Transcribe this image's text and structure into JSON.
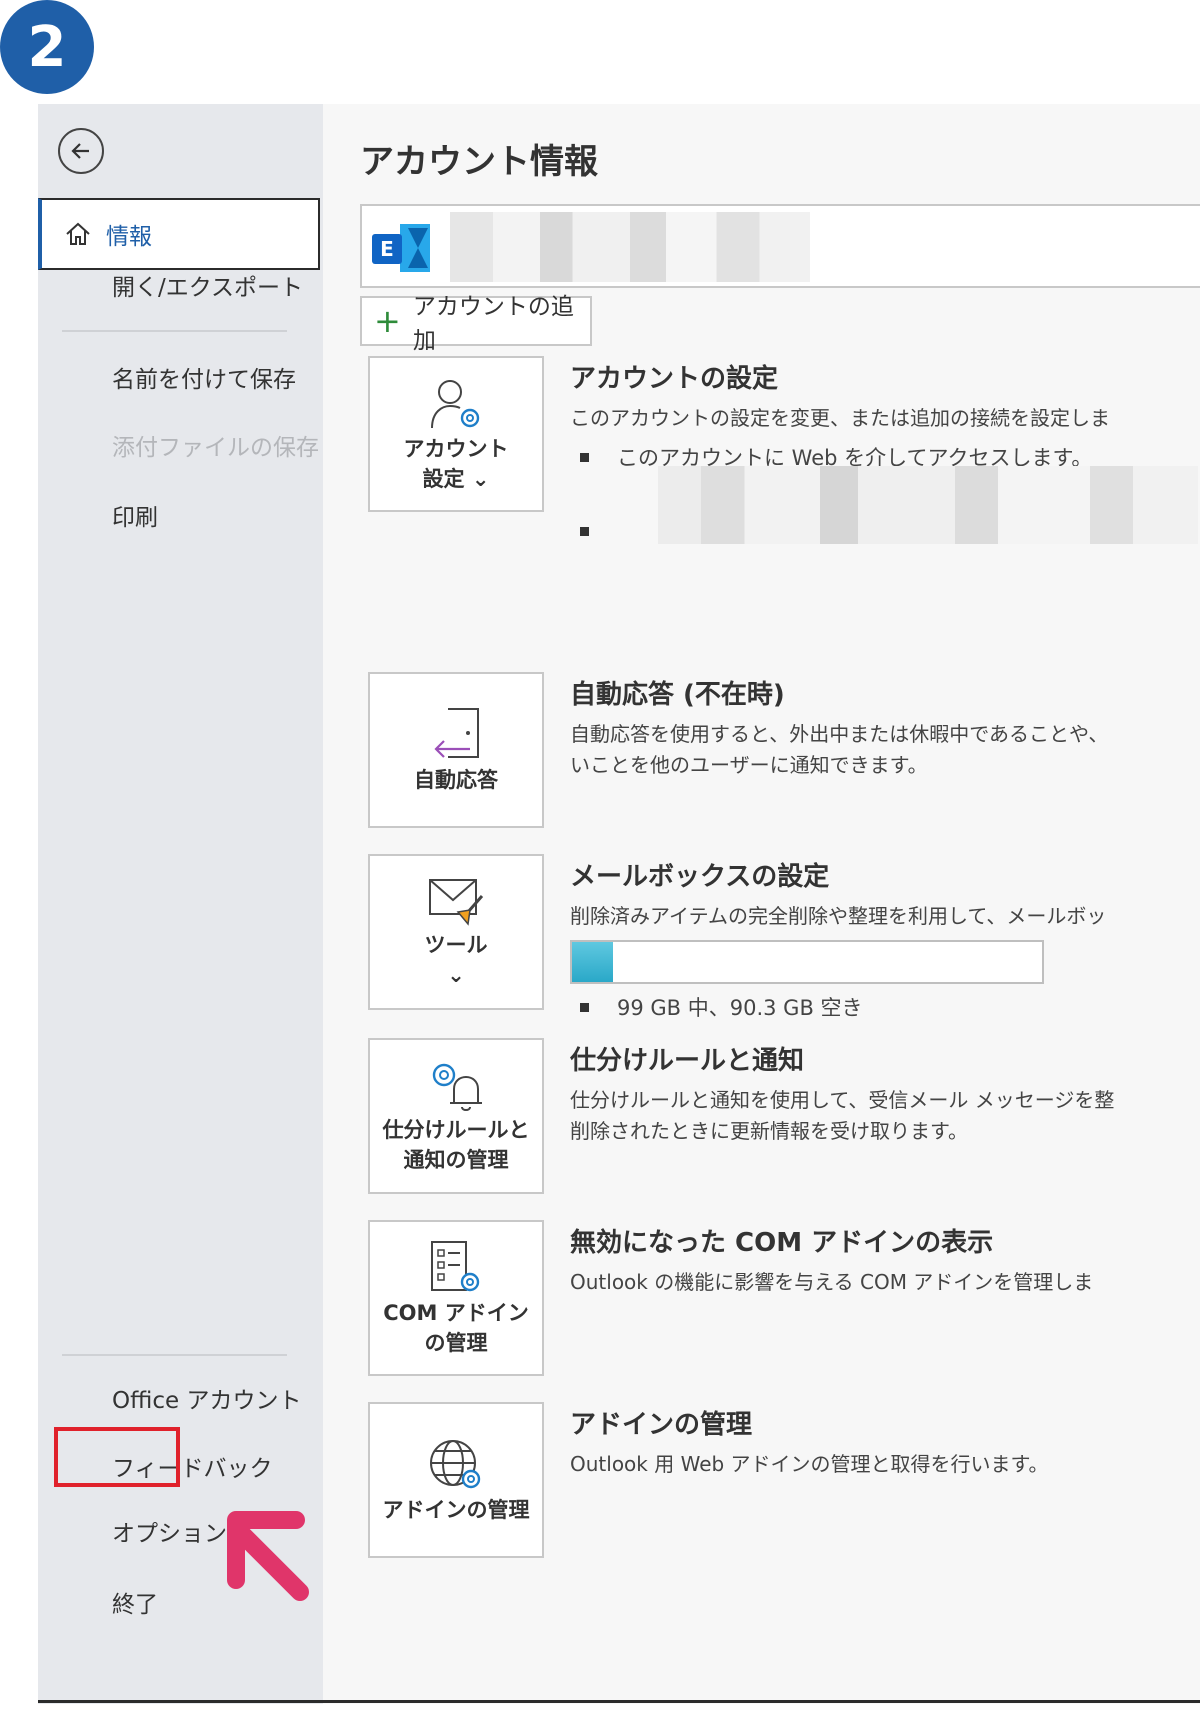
{
  "step_number": "2",
  "sidebar": {
    "back_icon": "back-arrow-circle-icon",
    "items": [
      {
        "label": "情報",
        "active": true
      },
      {
        "label": "開く/エクスポート"
      },
      {
        "label": "名前を付けて保存"
      },
      {
        "label": "添付ファイルの保存",
        "disabled": true
      },
      {
        "label": "印刷"
      },
      {
        "label": "Office アカウント"
      },
      {
        "label": "フィードバック"
      },
      {
        "label": "オプション",
        "highlighted": true
      },
      {
        "label": "終了"
      }
    ]
  },
  "main": {
    "title": "アカウント情報",
    "add_account_label": "アカウントの追加",
    "sections": [
      {
        "tile_label": "アカウント\n設定 ⌄",
        "title": "アカウントの設定",
        "description": "このアカウントの設定を変更、または追加の接続を設定しま",
        "bullets": [
          "このアカウントに Web を介してアクセスします。"
        ]
      },
      {
        "tile_label": "自動応答",
        "title": "自動応答 (不在時)",
        "description": "自動応答を使用すると、外出中または休暇中であることや、\nいことを他のユーザーに通知できます。"
      },
      {
        "tile_label": "ツール\n⌄",
        "title": "メールボックスの設定",
        "description": "削除済みアイテムの完全削除や整理を利用して、メールボッ",
        "storage_used_fraction": 0.088,
        "storage_text": "99 GB 中、90.3 GB 空き"
      },
      {
        "tile_label": "仕分けルールと\n通知の管理",
        "title": "仕分けルールと通知",
        "description": "仕分けルールと通知を使用して、受信メール メッセージを整\n削除されたときに更新情報を受け取ります。"
      },
      {
        "tile_label": "COM アドイン\nの管理",
        "title": "無効になった COM アドインの表示",
        "description": "Outlook の機能に影響を与える COM アドインを管理しま"
      },
      {
        "tile_label": "アドインの管理",
        "title": "アドインの管理",
        "description": "Outlook 用 Web アドインの管理と取得を行います。"
      }
    ]
  },
  "colors": {
    "accent": "#1f5fa8",
    "highlight": "#e0212b",
    "arrow": "#e0356a"
  }
}
